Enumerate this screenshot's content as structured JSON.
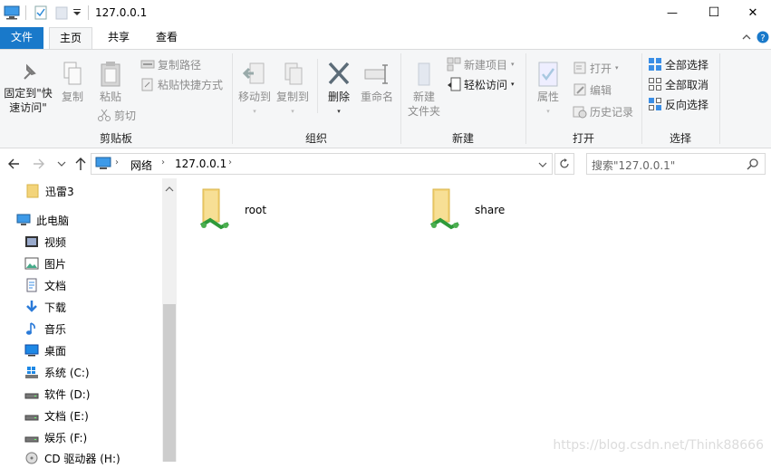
{
  "window": {
    "title": "127.0.0.1",
    "controls": {
      "minimize": "—",
      "maximize": "☐",
      "close": "✕"
    }
  },
  "tabs": {
    "file": "文件",
    "home": "主页",
    "share": "共享",
    "view": "查看"
  },
  "ribbon": {
    "clipboard": {
      "label": "剪贴板",
      "pin_line1": "固定到\"快",
      "pin_line2": "速访问\"",
      "copy": "复制",
      "paste": "粘贴",
      "copy_path": "复制路径",
      "paste_shortcut": "粘贴快捷方式",
      "cut": "剪切"
    },
    "organize": {
      "label": "组织",
      "move_to": "移动到",
      "copy_to": "复制到",
      "delete": "删除",
      "rename": "重命名"
    },
    "new": {
      "label": "新建",
      "new_folder_line1": "新建",
      "new_folder_line2": "文件夹",
      "new_item": "新建项目",
      "easy_access": "轻松访问"
    },
    "open": {
      "label": "打开",
      "properties": "属性",
      "open": "打开",
      "edit": "编辑",
      "history": "历史记录"
    },
    "select": {
      "label": "选择",
      "select_all": "全部选择",
      "select_none": "全部取消",
      "invert": "反向选择"
    }
  },
  "address": {
    "crumb1": "网络",
    "crumb2": "127.0.0.1",
    "search_placeholder": "搜索\"127.0.0.1\""
  },
  "nav_pane": {
    "items": [
      {
        "label": "迅雷3",
        "icon": "folder-yellow-icon"
      },
      {
        "label": "此电脑",
        "icon": "computer-icon"
      },
      {
        "label": "视频",
        "icon": "video-icon"
      },
      {
        "label": "图片",
        "icon": "picture-icon"
      },
      {
        "label": "文档",
        "icon": "document-icon"
      },
      {
        "label": "下载",
        "icon": "download-icon"
      },
      {
        "label": "音乐",
        "icon": "music-icon"
      },
      {
        "label": "桌面",
        "icon": "desktop-icon"
      },
      {
        "label": "系统 (C:)",
        "icon": "windows-drive-icon"
      },
      {
        "label": "软件 (D:)",
        "icon": "drive-icon"
      },
      {
        "label": "文档 (E:)",
        "icon": "drive-icon"
      },
      {
        "label": "娱乐 (F:)",
        "icon": "drive-icon"
      },
      {
        "label": "CD 驱动器 (H:)",
        "icon": "cd-drive-icon"
      }
    ]
  },
  "content": {
    "items": [
      {
        "name": "root",
        "icon": "network-share-folder-icon"
      },
      {
        "name": "share",
        "icon": "network-share-folder-icon"
      }
    ]
  },
  "watermark": "https://blog.csdn.net/Think88666",
  "colors": {
    "file_tab": "#1979ca",
    "ribbon_bg": "#f5f6f7",
    "folder": "#f3d47a"
  }
}
